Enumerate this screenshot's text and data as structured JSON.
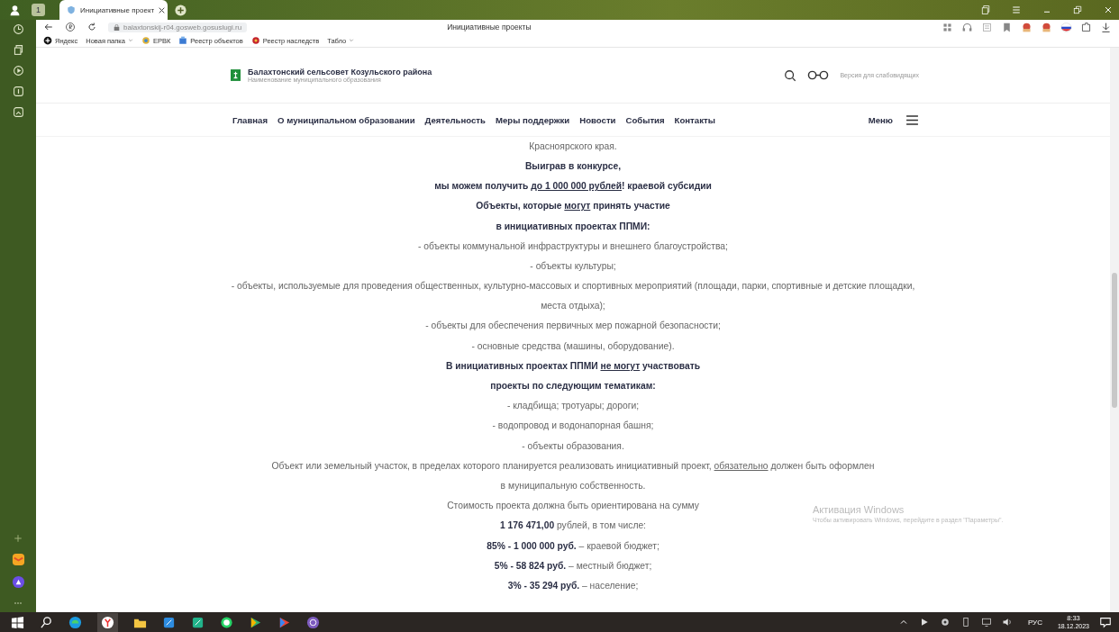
{
  "browser": {
    "tab_count": "1",
    "tabs": [
      {
        "title": "Инициативные проект",
        "selected": true
      }
    ],
    "address": "balaxtonskij-r04.gosweb.gosuslugi.ru",
    "page_title": "Инициативные проекты",
    "bookmarks": [
      {
        "label": "Яндекс",
        "dropdown": false
      },
      {
        "label": "Новая папка",
        "dropdown": true
      },
      {
        "label": "ЕРВК",
        "dropdown": false
      },
      {
        "label": "Реестр объектов",
        "dropdown": false
      },
      {
        "label": "Реестр наследств",
        "dropdown": false
      },
      {
        "label": "Табло",
        "dropdown": true
      }
    ]
  },
  "site": {
    "title": "Балахтонский сельсовет Козульского района",
    "subtitle": "Наименование муниципального образования",
    "accessibility_link": "Версия для слабовидящих",
    "nav": [
      "Главная",
      "О муниципальном образовании",
      "Деятельность",
      "Меры поддержки",
      "Новости",
      "События",
      "Контакты"
    ],
    "menu_label": "Меню"
  },
  "content": [
    {
      "runs": [
        {
          "text": "Красноярского края.",
          "bold": false,
          "underline": false
        }
      ]
    },
    {
      "runs": [
        {
          "text": "Выиграв в конкурсе,",
          "bold": true,
          "underline": false
        }
      ]
    },
    {
      "runs": [
        {
          "text": "мы можем получить ",
          "bold": true,
          "underline": false
        },
        {
          "text": "до 1 000 000 рублей",
          "bold": true,
          "underline": true
        },
        {
          "text": "! краевой субсидии",
          "bold": true,
          "underline": false
        }
      ]
    },
    {
      "runs": [
        {
          "text": "Объекты, которые ",
          "bold": true,
          "underline": false
        },
        {
          "text": "могут",
          "bold": true,
          "underline": true
        },
        {
          "text": " принять участие",
          "bold": true,
          "underline": false
        }
      ]
    },
    {
      "runs": [
        {
          "text": "в инициативных проектах ППМИ:",
          "bold": true,
          "underline": false
        }
      ]
    },
    {
      "runs": [
        {
          "text": "- объекты коммунальной инфраструктуры и внешнего благоустройства;",
          "bold": false,
          "underline": false
        }
      ]
    },
    {
      "runs": [
        {
          "text": "- объекты культуры;",
          "bold": false,
          "underline": false
        }
      ]
    },
    {
      "runs": [
        {
          "text": "- объекты, используемые для проведения общественных, культурно-массовых и спортивных мероприятий (площади, парки, спортивные и детские площадки,",
          "bold": false,
          "underline": false
        }
      ]
    },
    {
      "runs": [
        {
          "text": "места отдыха);",
          "bold": false,
          "underline": false
        }
      ]
    },
    {
      "runs": [
        {
          "text": "- объекты для обеспечения первичных мер пожарной безопасности;",
          "bold": false,
          "underline": false
        }
      ]
    },
    {
      "runs": [
        {
          "text": "- основные средства (машины, оборудование).",
          "bold": false,
          "underline": false
        }
      ]
    },
    {
      "runs": [
        {
          "text": "В инициативных проектах ППМИ ",
          "bold": true,
          "underline": false
        },
        {
          "text": "не могут",
          "bold": true,
          "underline": true
        },
        {
          "text": " участвовать",
          "bold": true,
          "underline": false
        }
      ]
    },
    {
      "runs": [
        {
          "text": "проекты по следующим тематикам:",
          "bold": true,
          "underline": false
        }
      ]
    },
    {
      "runs": [
        {
          "text": "- кладбища; тротуары; дороги;",
          "bold": false,
          "underline": false
        }
      ]
    },
    {
      "runs": [
        {
          "text": "- водопровод и водонапорная башня;",
          "bold": false,
          "underline": false
        }
      ]
    },
    {
      "runs": [
        {
          "text": "- объекты образования.",
          "bold": false,
          "underline": false
        }
      ]
    },
    {
      "runs": [
        {
          "text": "Объект или земельный участок, в пределах которого планируется реализовать инициативный проект, ",
          "bold": false,
          "underline": false
        },
        {
          "text": "обязательно",
          "bold": false,
          "underline": true
        },
        {
          "text": " должен быть оформлен",
          "bold": false,
          "underline": false
        }
      ]
    },
    {
      "runs": [
        {
          "text": "в муниципальную собственность.",
          "bold": false,
          "underline": false
        }
      ]
    },
    {
      "runs": [
        {
          "text": "Стоимость проекта должна быть ориентирована на сумму",
          "bold": false,
          "underline": false
        }
      ]
    },
    {
      "runs": [
        {
          "text": "1 176 471,00",
          "bold": true,
          "underline": false
        },
        {
          "text": " рублей, в том числе:",
          "bold": false,
          "underline": false
        }
      ]
    },
    {
      "runs": [
        {
          "text": "85% - 1 000 000 руб.",
          "bold": true,
          "underline": false
        },
        {
          "text": " – краевой бюджет;",
          "bold": false,
          "underline": false
        }
      ]
    },
    {
      "runs": [
        {
          "text": "5% - 58 824 руб.",
          "bold": true,
          "underline": false
        },
        {
          "text": " – местный бюджет;",
          "bold": false,
          "underline": false
        }
      ]
    },
    {
      "runs": [
        {
          "text": "3% - 35 294 руб.",
          "bold": true,
          "underline": false
        },
        {
          "text": " – население;",
          "bold": false,
          "underline": false
        }
      ]
    }
  ],
  "windows_activation": {
    "title": "Активация Windows",
    "text": "Чтобы активировать Windows, перейдите в раздел \"Параметры\"."
  },
  "taskbar": {
    "language": "РУС",
    "time": "8:33",
    "date": "18.12.2023"
  }
}
